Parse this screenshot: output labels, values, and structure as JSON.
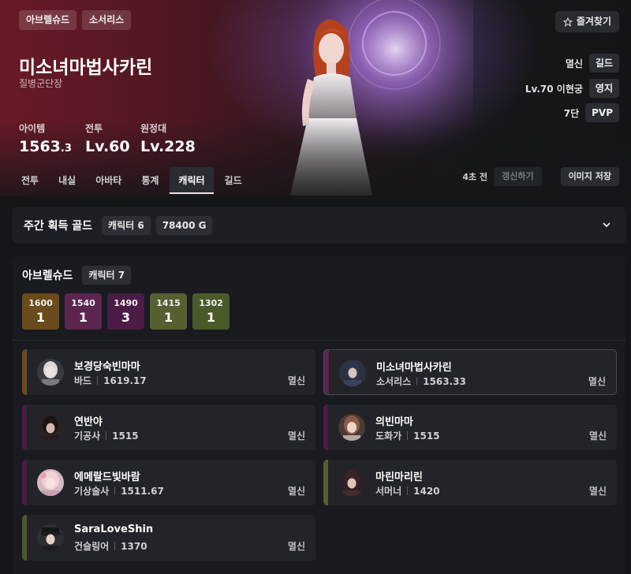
{
  "header": {
    "server_tag": "아브렐슈드",
    "class_tag": "소서리스",
    "name": "미소녀마법사카린",
    "title": "질병군단장",
    "stats": [
      {
        "label": "아이템",
        "value_main": "1563",
        "value_small": ".3"
      },
      {
        "label": "전투",
        "value_main": "Lv.60",
        "value_small": ""
      },
      {
        "label": "원정대",
        "value_main": "Lv.228",
        "value_small": ""
      }
    ],
    "favorite_label": "즐겨찾기",
    "info": [
      {
        "label": "멸신",
        "pill": "길드"
      },
      {
        "label": "Lv.70 이현궁",
        "pill": "영지"
      },
      {
        "label": "7단",
        "pill": "PVP"
      }
    ],
    "tabs": [
      "전투",
      "내실",
      "아바타",
      "통계",
      "캐릭터",
      "길드"
    ],
    "active_tab": "캐릭터",
    "refresh_time": "4초 전",
    "refresh_label": "갱신하기",
    "save_label": "이미지 저장"
  },
  "weekly_gold": {
    "title": "주간 획득 골드",
    "character_chip": "캐릭터 6",
    "gold_chip": "78400 G"
  },
  "server": {
    "name": "아브렐슈드",
    "character_chip": "캐릭터 7",
    "badges": [
      {
        "level": "1600",
        "count": "1",
        "color": "#6b4a1c"
      },
      {
        "level": "1540",
        "count": "1",
        "color": "#5b2550"
      },
      {
        "level": "1490",
        "count": "3",
        "color": "#4b1c45"
      },
      {
        "level": "1415",
        "count": "1",
        "color": "#54602f"
      },
      {
        "level": "1302",
        "count": "1",
        "color": "#4a5a28"
      }
    ],
    "characters": [
      {
        "name": "보경당숙빈마마",
        "class": "바드",
        "level": "1619.17",
        "guild": "멸신",
        "bar": "#6b4a1c"
      },
      {
        "name": "미소녀마법사카린",
        "class": "소서리스",
        "level": "1563.33",
        "guild": "멸신",
        "bar": "#5b2550"
      },
      {
        "name": "연반야",
        "class": "기공사",
        "level": "1515",
        "guild": "멸신",
        "bar": "#4b1c45"
      },
      {
        "name": "의빈마마",
        "class": "도화가",
        "level": "1515",
        "guild": "멸신",
        "bar": "#4b1c45"
      },
      {
        "name": "에메랄드빛바람",
        "class": "기상술사",
        "level": "1511.67",
        "guild": "멸신",
        "bar": "#4b1c45"
      },
      {
        "name": "마린마리린",
        "class": "서머너",
        "level": "1420",
        "guild": "멸신",
        "bar": "#54602f"
      },
      {
        "name": "SaraLoveShin",
        "class": "건슬링어",
        "level": "1370",
        "guild": "멸신",
        "bar": "#4a5a28"
      }
    ]
  }
}
